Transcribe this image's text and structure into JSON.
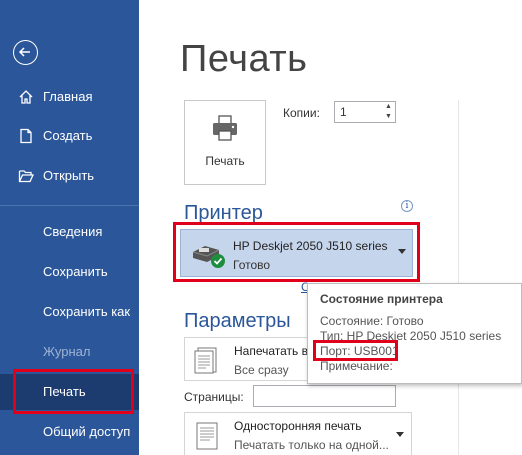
{
  "sidebar": {
    "back_icon": "back-arrow-icon",
    "items": [
      {
        "label": "Главная",
        "icon": "home-icon"
      },
      {
        "label": "Создать",
        "icon": "new-document-icon"
      },
      {
        "label": "Открыть",
        "icon": "open-folder-icon"
      },
      {
        "label": "Сведения"
      },
      {
        "label": "Сохранить"
      },
      {
        "label": "Сохранить как"
      },
      {
        "label": "Журнал",
        "disabled": true
      },
      {
        "label": "Печать",
        "active": true
      },
      {
        "label": "Общий доступ"
      }
    ]
  },
  "main": {
    "title": "Печать",
    "print_button_label": "Печать",
    "copies_label": "Копии:",
    "copies_value": "1",
    "printer_section_title": "Принтер",
    "printer": {
      "name": "HP Deskjet 2050 J510 series",
      "status": "Готово"
    },
    "printer_props_link": "С",
    "params_section_title": "Параметры",
    "print_range": {
      "line1": "Напечатать вс",
      "line2": "Все сразу"
    },
    "pages_label": "Страницы:",
    "pages_value": "",
    "sides": {
      "line1": "Односторонняя печать",
      "line2": "Печатать только на одной..."
    }
  },
  "tooltip": {
    "title": "Состояние принтера",
    "status": "Состояние: Готово",
    "type": "Тип: HP Deskjet 2050 J510 series",
    "port": "Порт: USB001",
    "note": "Примечание:"
  },
  "colors": {
    "sidebar_bg": "#2b579a",
    "sidebar_active": "#1c3c70",
    "accent": "#2b579a",
    "highlight_outline": "#e0001b",
    "printer_select_bg": "#c5d5ec"
  }
}
